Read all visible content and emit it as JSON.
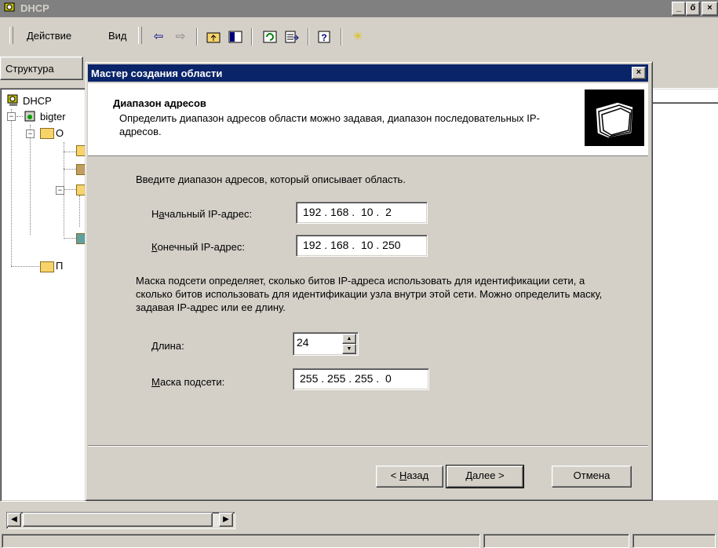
{
  "window": {
    "title": "DHCP",
    "min_btn": "_",
    "max_btn": "ő",
    "close_btn": "×"
  },
  "menu": {
    "action": "Действие",
    "view": "Вид"
  },
  "toolbar": {
    "icons": [
      "back-arrow-icon",
      "forward-arrow-icon",
      "up-folder-icon",
      "show-hide-tree-icon",
      "refresh-icon",
      "export-list-icon",
      "help-icon",
      "new-scope-icon"
    ],
    "back": "⇦",
    "forward": "⇨",
    "new": "✳"
  },
  "tabs": {
    "structure": "Структура"
  },
  "tree": {
    "root": "DHCP",
    "server": "bigter",
    "scope": "О",
    "server_options": "П"
  },
  "statusbar": {
    "segments": [
      "",
      "",
      ""
    ]
  },
  "dialog": {
    "title": "Мастер создания области",
    "close": "×",
    "header_title": "Диапазон адресов",
    "header_desc": "Определить диапазон адресов области можно задавая, диапазон последовательных IP-адресов.",
    "intro": "Введите диапазон адресов, который описывает область.",
    "start_ip": {
      "label_pre": "Н",
      "label_u": "а",
      "label_post": "чальный IP-адрес:",
      "value": "192 . 168 .  10 .  2"
    },
    "end_ip": {
      "label_u": "К",
      "label_post": "онечный IP-адрес:",
      "value": "192 . 168 .  10 . 250"
    },
    "mask_desc": "Маска подсети определяет, сколько битов IP-адреса использовать для идентификации сети, а сколько битов использовать для идентификации узла внутри этой сети. Можно определить маску, задавая IP-адрес или ее длину.",
    "length": {
      "label_u": "Д",
      "label_post": "лина:",
      "value": "24"
    },
    "mask": {
      "label_u": "М",
      "label_post": "аска подсети:",
      "value": "255 . 255 . 255 .  0"
    },
    "buttons": {
      "back_pre": "< ",
      "back_u": "Н",
      "back_post": "азад",
      "next": "Далее >",
      "cancel": "Отмена"
    }
  },
  "colors": {
    "face": "#d4d0c8",
    "active_title": "#0a246a",
    "inactive_title": "#808080"
  }
}
